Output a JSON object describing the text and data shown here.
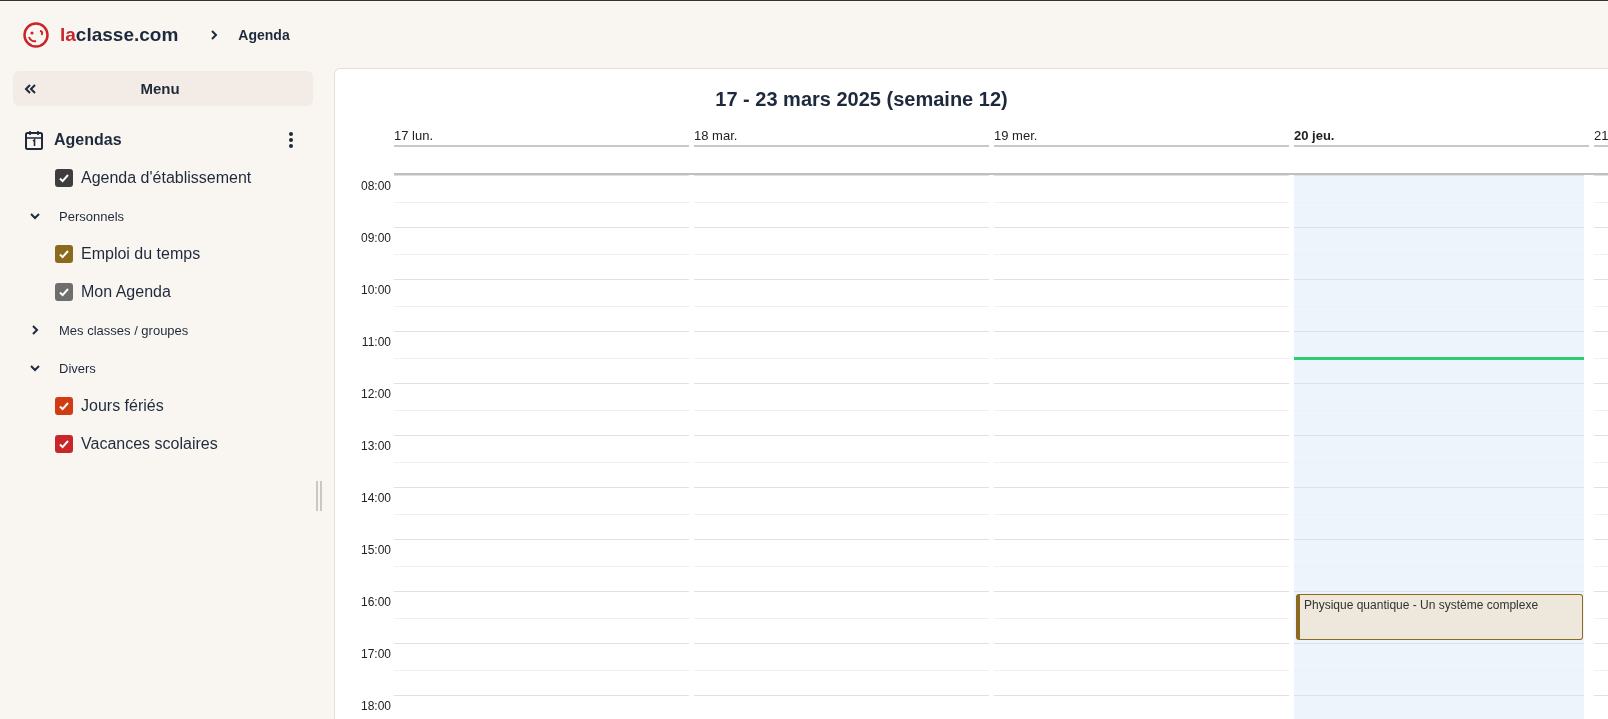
{
  "header": {
    "logo": {
      "accent": "la",
      "rest": "classe.com"
    },
    "breadcrumb": "Agenda"
  },
  "sidebar": {
    "menu_label": "Menu",
    "section": {
      "title": "Agendas",
      "items": [
        {
          "kind": "checkbox",
          "label": "Agenda d'établissement",
          "checked": true,
          "color": "#3d3d3d"
        },
        {
          "kind": "group",
          "label": "Personnels",
          "expanded": true,
          "children": [
            {
              "kind": "checkbox",
              "label": "Emploi du temps",
              "checked": true,
              "color": "#8b6a1f"
            },
            {
              "kind": "checkbox",
              "label": "Mon Agenda",
              "checked": true,
              "color": "#6e6e6e"
            }
          ]
        },
        {
          "kind": "group",
          "label": "Mes classes / groupes",
          "expanded": false
        },
        {
          "kind": "group",
          "label": "Divers",
          "expanded": true,
          "children": [
            {
              "kind": "checkbox",
              "label": "Jours fériés",
              "checked": true,
              "color": "#d13b12"
            },
            {
              "kind": "checkbox",
              "label": "Vacances scolaires",
              "checked": true,
              "color": "#c9262c"
            }
          ]
        }
      ]
    }
  },
  "calendar": {
    "title": "17 - 23 mars 2025 (semaine 12)",
    "days": [
      {
        "label": "17 lun.",
        "today": false
      },
      {
        "label": "18 mar.",
        "today": false
      },
      {
        "label": "19 mer.",
        "today": false
      },
      {
        "label": "20 jeu.",
        "today": true
      },
      {
        "label": "21",
        "today": false
      }
    ],
    "hours": [
      {
        "label": "08:00"
      },
      {
        "label": "09:00"
      },
      {
        "label": "10:00"
      },
      {
        "label": "11:00"
      },
      {
        "label": "12:00"
      },
      {
        "label": "13:00"
      },
      {
        "label": "14:00"
      },
      {
        "label": "15:00"
      },
      {
        "label": "16:00",
        "events": [
          {
            "title": "Physique quantique - Un système complexe",
            "color": "#8b6a1f"
          }
        ]
      },
      {
        "label": "17:00"
      },
      {
        "label": "18:00"
      }
    ]
  }
}
